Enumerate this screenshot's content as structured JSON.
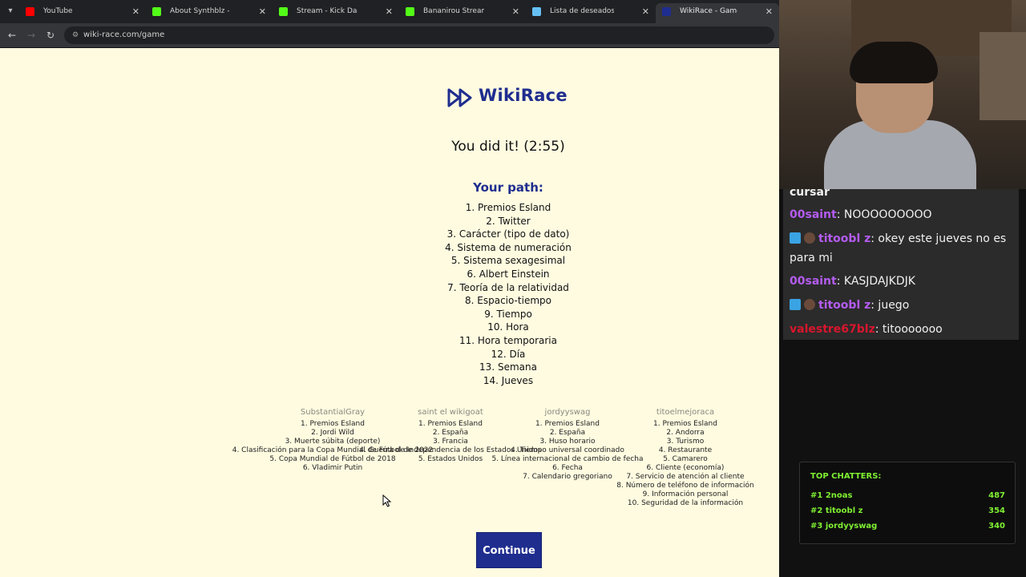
{
  "browser": {
    "tabs": [
      {
        "title": "YouTube",
        "favicon_color": "#ff0000"
      },
      {
        "title": "About Synthblz - Watch Live on Kick",
        "favicon_color": "#53fc18"
      },
      {
        "title": "Stream - Kick Dashboard",
        "favicon_color": "#53fc18"
      },
      {
        "title": "Bananirou Stream - Watch Live on Kick",
        "favicon_color": "#53fc18"
      },
      {
        "title": "Lista de deseados de Synth",
        "favicon_color": "#66c0f4"
      },
      {
        "title": "WikiRace - Game",
        "favicon_color": "#1f2d8f"
      }
    ],
    "close_glyph": "✕",
    "url": "wiki-race.com/game"
  },
  "game": {
    "brand": "WikiRace",
    "success_message": "You did it! (2:55)",
    "path_heading": "Your path:",
    "path": [
      "1. Premios Esland",
      "2. Twitter",
      "3. Carácter (tipo de dato)",
      "4. Sistema de numeración",
      "5. Sistema sexagesimal",
      "6. Albert Einstein",
      "7. Teoría de la relatividad",
      "8. Espacio-tiempo",
      "9. Tiempo",
      "10. Hora",
      "11. Hora temporaria",
      "12. Día",
      "13. Semana",
      "14. Jueves"
    ],
    "players": [
      {
        "name": "SubstantialGray",
        "path": [
          "1. Premios Esland",
          "2. Jordi Wild",
          "3. Muerte súbita (deporte)",
          "4. Clasificación para la Copa Mundial de Fútbol de 2022",
          "5. Copa Mundial de Fútbol de 2018",
          "6. Vladimir Putin"
        ]
      },
      {
        "name": "saint el wikigoat",
        "path": [
          "1. Premios Esland",
          "2. España",
          "3. Francia",
          "4. Guerra de Independencia de los Estados Unidos",
          "5. Estados Unidos"
        ]
      },
      {
        "name": "jordyyswag",
        "path": [
          "1. Premios Esland",
          "2. España",
          "3. Huso horario",
          "4. Tiempo universal coordinado",
          "5. Línea internacional de cambio de fecha",
          "6. Fecha",
          "7. Calendario gregoriano"
        ]
      },
      {
        "name": "titoelmejoraca",
        "path": [
          "1. Premios Esland",
          "2. Andorra",
          "3. Turismo",
          "4. Restaurante",
          "5. Camarero",
          "6. Cliente (economía)",
          "7. Servicio de atención al cliente",
          "8. Número de teléfono de información",
          "9. Información personal",
          "10. Seguridad de la información"
        ]
      }
    ],
    "continue_label": "Continue"
  },
  "chat": {
    "messages": [
      {
        "user": "",
        "text": "cursar",
        "user_color": "#f0f0f0"
      },
      {
        "user": "00saint",
        "text": ": NOOOOOOOOO",
        "user_color": "#b45cf0"
      },
      {
        "user": "titoobl z",
        "text": ": okey este jueves no es para mi",
        "user_color": "#b45cf0"
      },
      {
        "user": "00saint",
        "text": ": KASJDAJKDJK",
        "user_color": "#b45cf0"
      },
      {
        "user": "titoobl z",
        "text": ": juego",
        "user_color": "#b45cf0"
      },
      {
        "user": "valestre67blz",
        "text": ": titooooooo",
        "user_color": "#d8162d"
      }
    ]
  },
  "top_chatters": {
    "title": "TOP CHATTERS:",
    "entries": [
      {
        "rank_name": "#1 2noas",
        "count": "487"
      },
      {
        "rank_name": "#2 titoobl z",
        "count": "354"
      },
      {
        "rank_name": "#3 jordyyswag",
        "count": "340"
      }
    ],
    "color": "#7ff032"
  }
}
